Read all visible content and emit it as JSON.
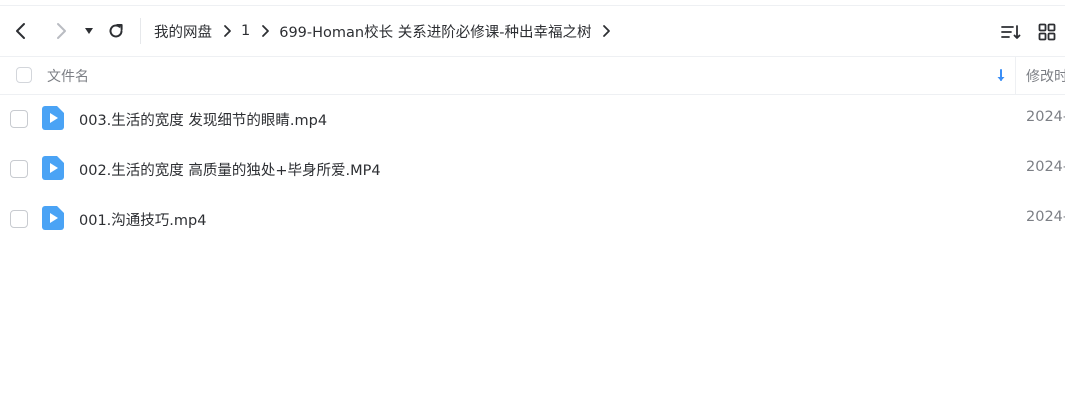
{
  "toolbar": {
    "breadcrumb": [
      "我的网盘",
      "1",
      "699-Homan校长 关系进阶必修课-种出幸福之树"
    ]
  },
  "file_list": {
    "header": {
      "name_label": "文件名",
      "modified_label": "修改时"
    },
    "files": [
      {
        "name": "003.生活的宽度 发现细节的眼睛.mp4",
        "modified": "2024-",
        "icon": "video-file-icon"
      },
      {
        "name": "002.生活的宽度 高质量的独处+毕身所爱.MP4",
        "modified": "2024-",
        "icon": "video-file-icon"
      },
      {
        "name": "001.沟通技巧.mp4",
        "modified": "2024-",
        "icon": "video-file-icon"
      }
    ]
  },
  "colors": {
    "accent": "#3a8ef6",
    "file_icon": "#4aa3f5",
    "text": "#2d2f33",
    "muted_text": "#7c7f85",
    "divider": "#eef0f3"
  }
}
